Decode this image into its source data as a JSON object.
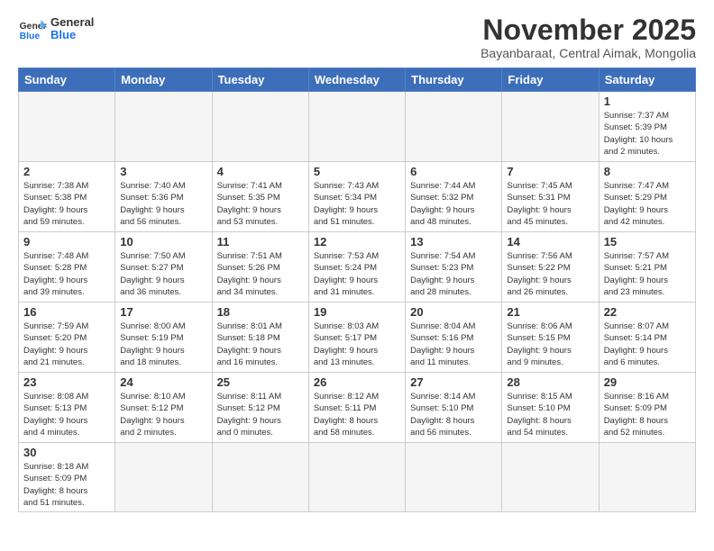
{
  "logo": {
    "general": "General",
    "blue": "Blue"
  },
  "title": "November 2025",
  "subtitle": "Bayanbaraat, Central Aimak, Mongolia",
  "weekdays": [
    "Sunday",
    "Monday",
    "Tuesday",
    "Wednesday",
    "Thursday",
    "Friday",
    "Saturday"
  ],
  "weeks": [
    [
      {
        "day": "",
        "info": ""
      },
      {
        "day": "",
        "info": ""
      },
      {
        "day": "",
        "info": ""
      },
      {
        "day": "",
        "info": ""
      },
      {
        "day": "",
        "info": ""
      },
      {
        "day": "",
        "info": ""
      },
      {
        "day": "1",
        "info": "Sunrise: 7:37 AM\nSunset: 5:39 PM\nDaylight: 10 hours\nand 2 minutes."
      }
    ],
    [
      {
        "day": "2",
        "info": "Sunrise: 7:38 AM\nSunset: 5:38 PM\nDaylight: 9 hours\nand 59 minutes."
      },
      {
        "day": "3",
        "info": "Sunrise: 7:40 AM\nSunset: 5:36 PM\nDaylight: 9 hours\nand 56 minutes."
      },
      {
        "day": "4",
        "info": "Sunrise: 7:41 AM\nSunset: 5:35 PM\nDaylight: 9 hours\nand 53 minutes."
      },
      {
        "day": "5",
        "info": "Sunrise: 7:43 AM\nSunset: 5:34 PM\nDaylight: 9 hours\nand 51 minutes."
      },
      {
        "day": "6",
        "info": "Sunrise: 7:44 AM\nSunset: 5:32 PM\nDaylight: 9 hours\nand 48 minutes."
      },
      {
        "day": "7",
        "info": "Sunrise: 7:45 AM\nSunset: 5:31 PM\nDaylight: 9 hours\nand 45 minutes."
      },
      {
        "day": "8",
        "info": "Sunrise: 7:47 AM\nSunset: 5:29 PM\nDaylight: 9 hours\nand 42 minutes."
      }
    ],
    [
      {
        "day": "9",
        "info": "Sunrise: 7:48 AM\nSunset: 5:28 PM\nDaylight: 9 hours\nand 39 minutes."
      },
      {
        "day": "10",
        "info": "Sunrise: 7:50 AM\nSunset: 5:27 PM\nDaylight: 9 hours\nand 36 minutes."
      },
      {
        "day": "11",
        "info": "Sunrise: 7:51 AM\nSunset: 5:26 PM\nDaylight: 9 hours\nand 34 minutes."
      },
      {
        "day": "12",
        "info": "Sunrise: 7:53 AM\nSunset: 5:24 PM\nDaylight: 9 hours\nand 31 minutes."
      },
      {
        "day": "13",
        "info": "Sunrise: 7:54 AM\nSunset: 5:23 PM\nDaylight: 9 hours\nand 28 minutes."
      },
      {
        "day": "14",
        "info": "Sunrise: 7:56 AM\nSunset: 5:22 PM\nDaylight: 9 hours\nand 26 minutes."
      },
      {
        "day": "15",
        "info": "Sunrise: 7:57 AM\nSunset: 5:21 PM\nDaylight: 9 hours\nand 23 minutes."
      }
    ],
    [
      {
        "day": "16",
        "info": "Sunrise: 7:59 AM\nSunset: 5:20 PM\nDaylight: 9 hours\nand 21 minutes."
      },
      {
        "day": "17",
        "info": "Sunrise: 8:00 AM\nSunset: 5:19 PM\nDaylight: 9 hours\nand 18 minutes."
      },
      {
        "day": "18",
        "info": "Sunrise: 8:01 AM\nSunset: 5:18 PM\nDaylight: 9 hours\nand 16 minutes."
      },
      {
        "day": "19",
        "info": "Sunrise: 8:03 AM\nSunset: 5:17 PM\nDaylight: 9 hours\nand 13 minutes."
      },
      {
        "day": "20",
        "info": "Sunrise: 8:04 AM\nSunset: 5:16 PM\nDaylight: 9 hours\nand 11 minutes."
      },
      {
        "day": "21",
        "info": "Sunrise: 8:06 AM\nSunset: 5:15 PM\nDaylight: 9 hours\nand 9 minutes."
      },
      {
        "day": "22",
        "info": "Sunrise: 8:07 AM\nSunset: 5:14 PM\nDaylight: 9 hours\nand 6 minutes."
      }
    ],
    [
      {
        "day": "23",
        "info": "Sunrise: 8:08 AM\nSunset: 5:13 PM\nDaylight: 9 hours\nand 4 minutes."
      },
      {
        "day": "24",
        "info": "Sunrise: 8:10 AM\nSunset: 5:12 PM\nDaylight: 9 hours\nand 2 minutes."
      },
      {
        "day": "25",
        "info": "Sunrise: 8:11 AM\nSunset: 5:12 PM\nDaylight: 9 hours\nand 0 minutes."
      },
      {
        "day": "26",
        "info": "Sunrise: 8:12 AM\nSunset: 5:11 PM\nDaylight: 8 hours\nand 58 minutes."
      },
      {
        "day": "27",
        "info": "Sunrise: 8:14 AM\nSunset: 5:10 PM\nDaylight: 8 hours\nand 56 minutes."
      },
      {
        "day": "28",
        "info": "Sunrise: 8:15 AM\nSunset: 5:10 PM\nDaylight: 8 hours\nand 54 minutes."
      },
      {
        "day": "29",
        "info": "Sunrise: 8:16 AM\nSunset: 5:09 PM\nDaylight: 8 hours\nand 52 minutes."
      }
    ],
    [
      {
        "day": "30",
        "info": "Sunrise: 8:18 AM\nSunset: 5:09 PM\nDaylight: 8 hours\nand 51 minutes."
      },
      {
        "day": "",
        "info": ""
      },
      {
        "day": "",
        "info": ""
      },
      {
        "day": "",
        "info": ""
      },
      {
        "day": "",
        "info": ""
      },
      {
        "day": "",
        "info": ""
      },
      {
        "day": "",
        "info": ""
      }
    ]
  ]
}
